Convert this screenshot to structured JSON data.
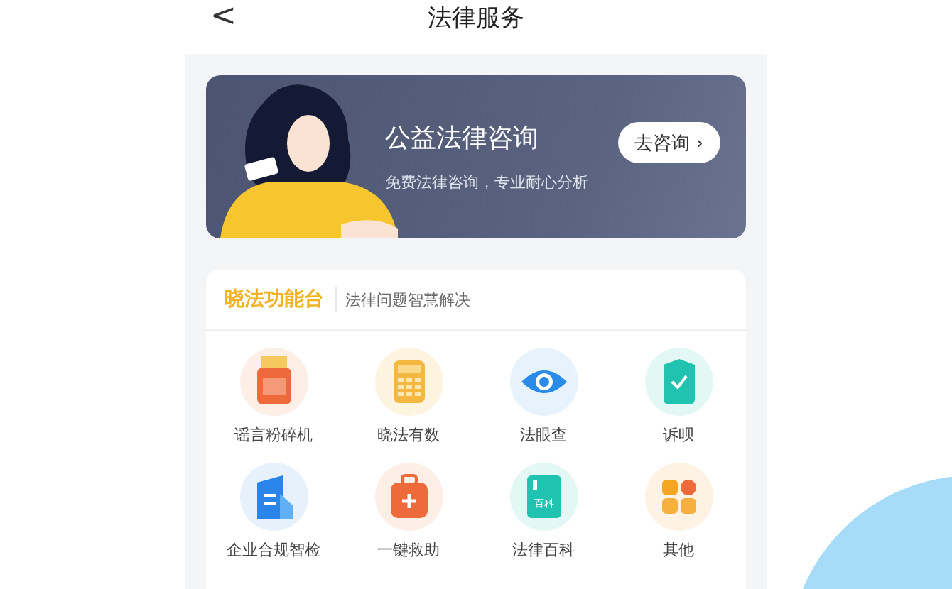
{
  "header": {
    "back": "<",
    "title": "法律服务"
  },
  "banner": {
    "title": "公益法律咨询",
    "subtitle": "免费法律咨询，专业耐心分析",
    "button": "去咨询",
    "button_arrow": "›"
  },
  "panel": {
    "title": "晓法功能台",
    "subtitle": "法律问题智慧解决",
    "items": [
      {
        "label": "谣言粉碎机",
        "kind": "shredder"
      },
      {
        "label": "晓法有数",
        "kind": "calculator"
      },
      {
        "label": "法眼查",
        "kind": "eye"
      },
      {
        "label": "诉呗",
        "kind": "shield"
      },
      {
        "label": "企业合规智检",
        "kind": "building"
      },
      {
        "label": "一键救助",
        "kind": "aidkit"
      },
      {
        "label": "法律百科",
        "kind": "book",
        "icon_text": "百科"
      },
      {
        "label": "其他",
        "kind": "grid"
      }
    ]
  }
}
